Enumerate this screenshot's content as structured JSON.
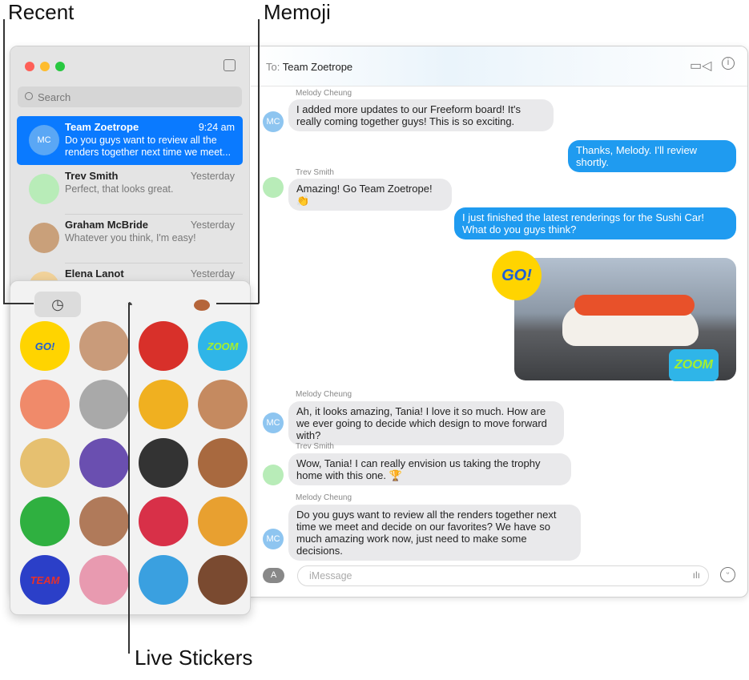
{
  "callouts": {
    "recent": "Recent",
    "memoji": "Memoji",
    "live_stickers": "Live Stickers"
  },
  "sidebar": {
    "search_placeholder": "Search",
    "conversations": [
      {
        "name": "Team Zoetrope",
        "time": "9:24 am",
        "preview": "Do you guys want to review all the renders together next time we meet...",
        "avatar": "MC",
        "selected": true
      },
      {
        "name": "Trev Smith",
        "time": "Yesterday",
        "preview": "Perfect, that looks great."
      },
      {
        "name": "Graham McBride",
        "time": "Yesterday",
        "preview": "Whatever you think, I'm easy!"
      },
      {
        "name": "Elena Lanot",
        "time": "Yesterday",
        "preview": ""
      }
    ]
  },
  "header": {
    "to_label": "To:",
    "recipient": "Team Zoetrope"
  },
  "messages": [
    {
      "sender": "Melody Cheung",
      "avatar": "MC",
      "text": "I added more updates to our Freeform board! It's really coming together guys! This is so exciting."
    },
    {
      "text": "Thanks, Melody. I'll review shortly."
    },
    {
      "sender": "Trev Smith",
      "text": "Amazing! Go Team Zoetrope! 👏"
    },
    {
      "text": "I just finished the latest renderings for the Sushi Car! What do you guys think?"
    },
    {
      "sender": "Melody Cheung",
      "avatar": "MC",
      "text": "Ah, it looks amazing, Tania! I love it so much. How are we ever going to decide which design to move forward with?"
    },
    {
      "sender": "Trev Smith",
      "text": "Wow, Tania! I can really envision us taking the trophy home with this one. 🏆"
    },
    {
      "sender": "Melody Cheung",
      "avatar": "MC",
      "text": "Do you guys want to review all the renders together next time we meet and decide on our favorites? We have so much amazing work now, just need to make some decisions."
    }
  ],
  "image_stickers": [
    "GO!",
    "ZOOM"
  ],
  "input": {
    "placeholder": "iMessage"
  },
  "stickers": [
    "GO!",
    "memoji-mindblown",
    "race-car",
    "ZOOM",
    "sushi",
    "cat",
    "flame-car",
    "memoji-kiss",
    "memoji-sunglasses",
    "monster-mouth",
    "checkered-flag",
    "memoji-heart-eyes",
    "recycle",
    "memoji-heart-hands",
    "foam-finger",
    "hot-air-balloon",
    "TEAM",
    "cactus-cup",
    "blue-car",
    "memoji-party"
  ]
}
